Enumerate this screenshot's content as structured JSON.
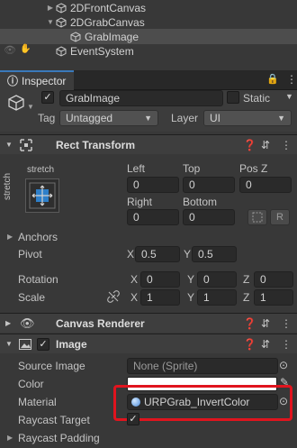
{
  "hierarchy": {
    "items": [
      {
        "label": "2DFrontCanvas"
      },
      {
        "label": "2DGrabCanvas"
      },
      {
        "label": "GrabImage"
      },
      {
        "label": "EventSystem"
      }
    ]
  },
  "inspector": {
    "tab_label": "Inspector",
    "object_name": "GrabImage",
    "static_label": "Static",
    "tag_label": "Tag",
    "tag_value": "Untagged",
    "layer_label": "Layer",
    "layer_value": "UI"
  },
  "rect_transform": {
    "title": "Rect Transform",
    "anchor_label": "stretch",
    "anchor_side_label": "stretch",
    "col_left": "Left",
    "col_top": "Top",
    "col_posz": "Pos Z",
    "left_value": "0",
    "top_value": "0",
    "posz_value": "0",
    "col_right": "Right",
    "col_bottom": "Bottom",
    "right_value": "0",
    "bottom_value": "0",
    "r_button": "R",
    "anchors_label": "Anchors",
    "pivot_label": "Pivot",
    "pivot_x": "0.5",
    "pivot_y": "0.5",
    "rotation_label": "Rotation",
    "rot_x": "0",
    "rot_y": "0",
    "rot_z": "0",
    "scale_label": "Scale",
    "scale_x": "1",
    "scale_y": "1",
    "scale_z": "1",
    "x": "X",
    "y": "Y",
    "z": "Z"
  },
  "canvas_renderer": {
    "title": "Canvas Renderer"
  },
  "image": {
    "title": "Image",
    "source_image_label": "Source Image",
    "source_image_value": "None (Sprite)",
    "color_label": "Color",
    "material_label": "Material",
    "material_value": "URPGrab_InvertColor",
    "raycast_target_label": "Raycast Target",
    "raycast_padding_label": "Raycast Padding"
  },
  "colors": {
    "highlight": "#e0141e",
    "color_swatch": "#ffffff"
  }
}
